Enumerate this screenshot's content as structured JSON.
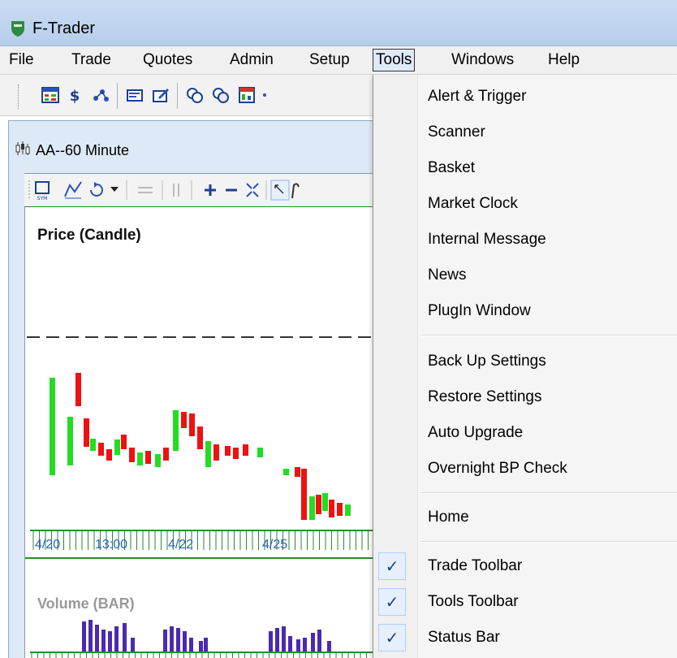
{
  "window": {
    "title": "F-Trader"
  },
  "menubar": {
    "items": [
      {
        "label": "File"
      },
      {
        "label": "Trade"
      },
      {
        "label": "Quotes"
      },
      {
        "label": "Admin"
      },
      {
        "label": "Setup"
      },
      {
        "label": "Tools"
      },
      {
        "label": "Windows"
      },
      {
        "label": "Help"
      }
    ],
    "active": "Tools"
  },
  "chart_window": {
    "title": "AA--60 Minute",
    "price_panel_title": "Price (Candle)",
    "volume_panel_title": "Volume (BAR)",
    "x_labels": [
      "4/20",
      "13:00",
      "4/22",
      "4/25"
    ]
  },
  "tools_menu": {
    "groups": [
      [
        "Alert & Trigger",
        "Scanner",
        "Basket",
        "Market Clock",
        "Internal Message",
        "News",
        "PlugIn Window"
      ],
      [
        "Back Up Settings",
        "Restore Settings",
        "Auto Upgrade",
        "Overnight BP Check"
      ],
      [
        "Home"
      ]
    ],
    "checked_items": [
      {
        "label": "Trade Toolbar",
        "checked": true
      },
      {
        "label": "Tools Toolbar",
        "checked": true
      },
      {
        "label": "Status Bar",
        "checked": true
      }
    ],
    "check_glyph": "✓"
  },
  "colors": {
    "up_candle": "#22dd22",
    "down_candle": "#ee1111",
    "volume_bar": "#4a2bb0",
    "axis_green": "#2b8a2b"
  }
}
